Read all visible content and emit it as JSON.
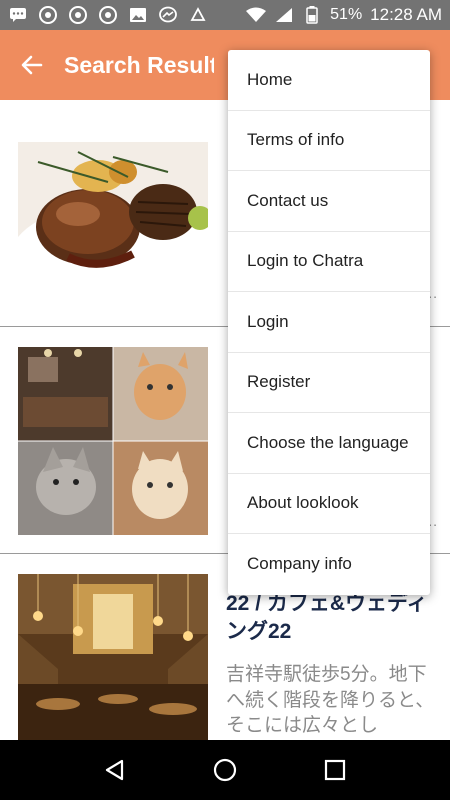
{
  "status_bar": {
    "battery": "51%",
    "time": "12:28 AM"
  },
  "app_bar": {
    "title": "Search Results"
  },
  "menu": {
    "items": [
      {
        "label": "Home"
      },
      {
        "label": "Terms of info"
      },
      {
        "label": "Contact us"
      },
      {
        "label": "Login to Chatra"
      },
      {
        "label": "Login"
      },
      {
        "label": "Register"
      },
      {
        "label": "Choose the language"
      },
      {
        "label": "About looklook"
      },
      {
        "label": "Company info"
      }
    ]
  },
  "results": {
    "r1": {
      "image": "food-photo",
      "ellipsis": "..."
    },
    "r2": {
      "image": "cat-cafe-collage",
      "ellipsis": "..."
    },
    "r3": {
      "image": "cafe-interior-photo",
      "title": "22 / カフェ&ウェディング22",
      "description": "吉祥寺駅徒歩5分。地下へ続く階段を降りると、そこには広々とし"
    }
  },
  "colors": {
    "accent": "#ef8c5e",
    "status_bar": "#737373",
    "title_text": "#1b2a4a"
  }
}
